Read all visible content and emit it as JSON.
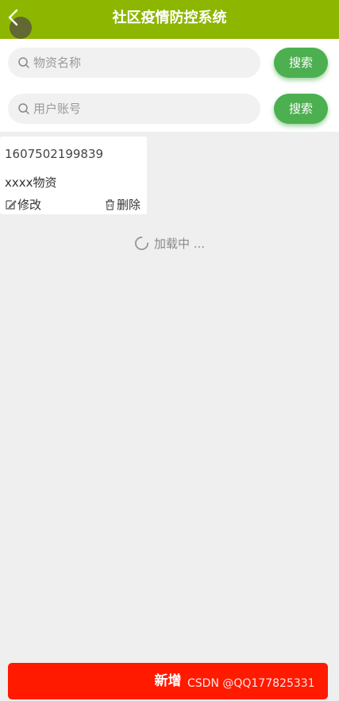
{
  "header": {
    "title": "社区疫情防控系统",
    "bg_color": "#8db600",
    "back_icon": "chevron-left-icon"
  },
  "search": [
    {
      "placeholder": "物资名称",
      "button_label": "搜索",
      "icon": "search-icon"
    },
    {
      "placeholder": "用户账号",
      "button_label": "搜索",
      "icon": "search-icon"
    }
  ],
  "accent_color": "#4caf50",
  "list": {
    "items": [
      {
        "code": "1607502199839",
        "name": "xxxx物资",
        "edit_label": "修改",
        "delete_label": "删除",
        "edit_icon": "edit-icon",
        "delete_icon": "trash-icon"
      }
    ],
    "loading_text": "加载中 ..."
  },
  "footer": {
    "add_label": "新增",
    "add_color": "#ff1a00"
  },
  "watermark": "CSDN @QQ177825331"
}
